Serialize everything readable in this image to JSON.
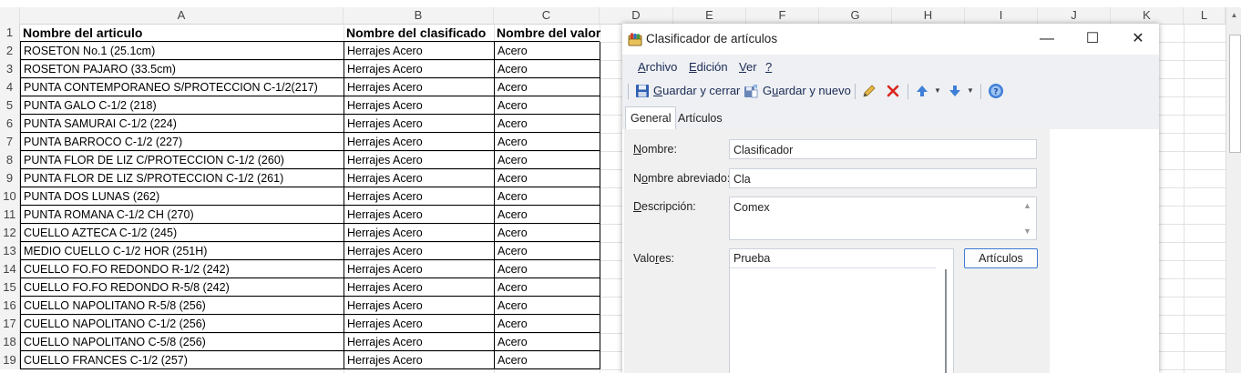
{
  "spreadsheet": {
    "columns": [
      "A",
      "B",
      "C",
      "D",
      "E",
      "F",
      "G",
      "H",
      "I",
      "J",
      "K",
      "L"
    ],
    "headers": {
      "articulo": "Nombre del articulo",
      "clasificado": "Nombre del clasificado",
      "valor": "Nombre del valor"
    },
    "row_numbers": [
      "1",
      "2",
      "3",
      "4",
      "5",
      "6",
      "7",
      "8",
      "9",
      "10",
      "11",
      "12",
      "13",
      "14",
      "15",
      "16",
      "17",
      "18",
      "19"
    ],
    "rows": [
      [
        "ROSETON No.1 (25.1cm)",
        "Herrajes Acero",
        "Acero"
      ],
      [
        "ROSETON PAJARO (33.5cm)",
        "Herrajes Acero",
        "Acero"
      ],
      [
        "PUNTA CONTEMPORANEO S/PROTECCION C-1/2(217)",
        "Herrajes Acero",
        "Acero"
      ],
      [
        "PUNTA GALO C-1/2 (218)",
        "Herrajes Acero",
        "Acero"
      ],
      [
        "PUNTA SAMURAI C-1/2 (224)",
        "Herrajes Acero",
        "Acero"
      ],
      [
        "PUNTA BARROCO C-1/2 (227)",
        "Herrajes Acero",
        "Acero"
      ],
      [
        "PUNTA FLOR DE LIZ C/PROTECCION C-1/2 (260)",
        "Herrajes Acero",
        "Acero"
      ],
      [
        "PUNTA FLOR DE LIZ S/PROTECCION C-1/2 (261)",
        "Herrajes Acero",
        "Acero"
      ],
      [
        "PUNTA DOS LUNAS (262)",
        "Herrajes Acero",
        "Acero"
      ],
      [
        "PUNTA ROMANA C-1/2 CH (270)",
        "Herrajes Acero",
        "Acero"
      ],
      [
        "CUELLO AZTECA C-1/2 (245)",
        "Herrajes Acero",
        "Acero"
      ],
      [
        "MEDIO CUELLO C-1/2 HOR (251H)",
        "Herrajes Acero",
        "Acero"
      ],
      [
        "CUELLO FO.FO REDONDO R-1/2 (242)",
        "Herrajes Acero",
        "Acero"
      ],
      [
        "CUELLO FO.FO REDONDO R-5/8 (242)",
        "Herrajes Acero",
        "Acero"
      ],
      [
        "CUELLO NAPOLITANO R-5/8 (256)",
        "Herrajes Acero",
        "Acero"
      ],
      [
        "CUELLO NAPOLITANO C-1/2 (256)",
        "Herrajes Acero",
        "Acero"
      ],
      [
        "CUELLO NAPOLITANO C-5/8 (256)",
        "Herrajes Acero",
        "Acero"
      ],
      [
        "CUELLO FRANCES C-1/2 (257)",
        "Herrajes Acero",
        "Acero"
      ]
    ]
  },
  "dialog": {
    "title": "Clasificador de artículos",
    "window_buttons": {
      "minimize": "—",
      "maximize": "☐",
      "close": "✕"
    },
    "menu": {
      "archivo": {
        "key": "A",
        "rest": "rchivo"
      },
      "edicion": {
        "key": "E",
        "rest": "dición"
      },
      "ver": {
        "key": "V",
        "rest": "er"
      },
      "help": "?"
    },
    "toolbar": {
      "guardar_cerrar": {
        "pre": "",
        "key": "G",
        "rest": "uardar y cerrar"
      },
      "guardar_nuevo": {
        "pre": "G",
        "key": "u",
        "rest": "ardar y nuevo"
      }
    },
    "tabs": [
      "General",
      "Artículos"
    ],
    "form": {
      "nombre": {
        "key": "N",
        "rest": "ombre:",
        "value": "Clasificador"
      },
      "nombre_abreviado": {
        "pre": "N",
        "key": "o",
        "rest": "mbre abreviado:",
        "value": "Cla"
      },
      "descripcion": {
        "pre": "",
        "key": "D",
        "rest": "escripción:",
        "value": "Comex"
      },
      "valores": {
        "pre": "Valo",
        "key": "r",
        "rest": "es:",
        "value": "Prueba"
      },
      "articulos_button": "Artículos"
    }
  },
  "icons": {
    "app": "folder-books-icon",
    "save": "floppy-save-icon",
    "save_new": "save-new-icon",
    "edit": "pencil-icon",
    "delete": "red-x-icon",
    "move_up": "arrow-up-icon",
    "move_down": "arrow-down-icon",
    "help": "help-circle-icon"
  },
  "colors": {
    "accent": "#3d7bd5",
    "menu_bg": "#eef0f3",
    "delete": "#d9261c"
  }
}
